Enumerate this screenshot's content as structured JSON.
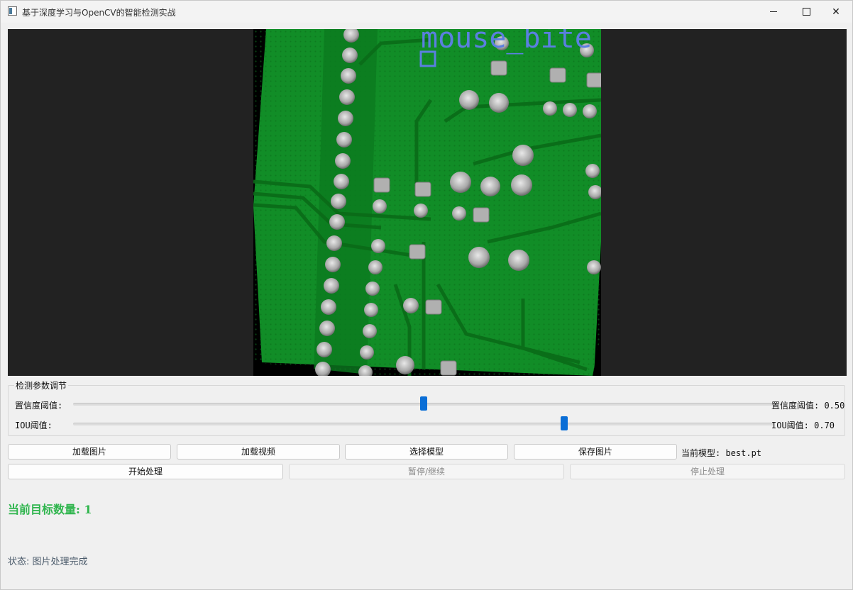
{
  "window": {
    "title": "基于深度学习与OpenCV的智能检测实战",
    "min_glyph": "—",
    "close_glyph": "✕"
  },
  "display": {
    "detection_label": "mouse_bite",
    "image_colors": {
      "board": "#0f8a24",
      "box": "#5b7fe0"
    }
  },
  "params": {
    "group_title": "检测参数调节",
    "conf": {
      "label": "置信度阈值:",
      "value_text": "置信度阈值: 0.50",
      "value": 0.5
    },
    "iou": {
      "label": "IOU阈值:",
      "value_text": "IOU阈值: 0.70",
      "value": 0.7
    }
  },
  "buttons": {
    "load_image": "加载图片",
    "load_video": "加载视频",
    "select_model": "选择模型",
    "save_image": "保存图片",
    "start": "开始处理",
    "pause": "暂停/继续",
    "stop": "停止处理"
  },
  "model": {
    "current_text": "当前模型: best.pt"
  },
  "result": {
    "count_text": "当前目标数量: 1"
  },
  "status": {
    "text": "状态: 图片处理完成"
  },
  "colors": {
    "accent": "#0a6ed6",
    "count_green": "#2fb54d",
    "display_bg": "#222222"
  }
}
